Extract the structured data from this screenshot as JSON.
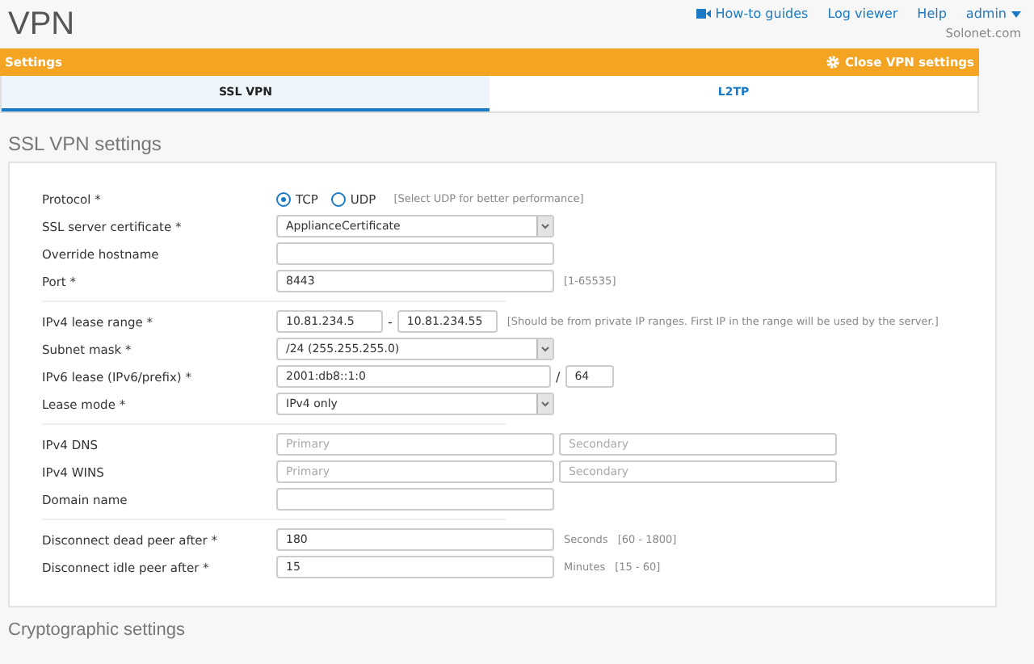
{
  "header": {
    "title": "VPN",
    "links": [
      {
        "label": "How-to guides",
        "kind": "video"
      },
      {
        "label": "Log viewer",
        "kind": "plain"
      },
      {
        "label": "Help",
        "kind": "plain"
      },
      {
        "label": "admin",
        "kind": "menu"
      }
    ],
    "site": "Solonet.com"
  },
  "settings_bar": {
    "title": "Settings",
    "action": "Close VPN settings"
  },
  "tabs": [
    {
      "label": "SSL VPN",
      "selected": true
    },
    {
      "label": "L2TP",
      "selected": false
    }
  ],
  "section_title": "SSL VPN settings",
  "groups": [
    {
      "fields": [
        {
          "kind": "radio",
          "label": "Protocol *",
          "options": [
            {
              "label": "TCP",
              "selected": true
            },
            {
              "label": "UDP",
              "selected": false
            }
          ],
          "hint": "[Select UDP for better performance]"
        },
        {
          "kind": "select",
          "label": "SSL server certificate *",
          "value": "ApplianceCertificate"
        },
        {
          "kind": "text",
          "label": "Override hostname"
        },
        {
          "kind": "text",
          "label": "Port *",
          "value": "8443",
          "hint": "[1-65535]"
        }
      ]
    },
    {
      "fields": [
        {
          "kind": "range",
          "label": "IPv4 lease range *",
          "from": "10.81.234.5",
          "separator": "-",
          "to": "10.81.234.55",
          "hint": "[Should be from private IP ranges. First IP in the range will be used by the server.]"
        },
        {
          "kind": "select",
          "label": "Subnet mask *",
          "value": "/24 (255.255.255.0)"
        },
        {
          "kind": "prefix",
          "label": "IPv6 lease (IPv6/prefix) *",
          "value": "2001:db8::1:0",
          "separator": "/",
          "prefix": "64"
        },
        {
          "kind": "select",
          "label": "Lease mode *",
          "value": "IPv4 only"
        }
      ]
    },
    {
      "fields": [
        {
          "kind": "pair",
          "label": "IPv4 DNS",
          "placeholder": "Primary",
          "placeholder_2": "Secondary"
        },
        {
          "kind": "pair",
          "label": "IPv4 WINS",
          "placeholder": "Primary",
          "placeholder_2": "Secondary"
        },
        {
          "kind": "text",
          "label": "Domain name"
        }
      ]
    },
    {
      "fields": [
        {
          "kind": "duration",
          "label": "Disconnect dead peer after *",
          "value": "180",
          "unit": "Seconds",
          "hint": "[60 - 1800]"
        },
        {
          "kind": "duration",
          "label": "Disconnect idle peer after *",
          "value": "15",
          "unit": "Minutes",
          "hint": "[15 - 60]"
        }
      ]
    }
  ],
  "next_section_title": "Cryptographic settings"
}
